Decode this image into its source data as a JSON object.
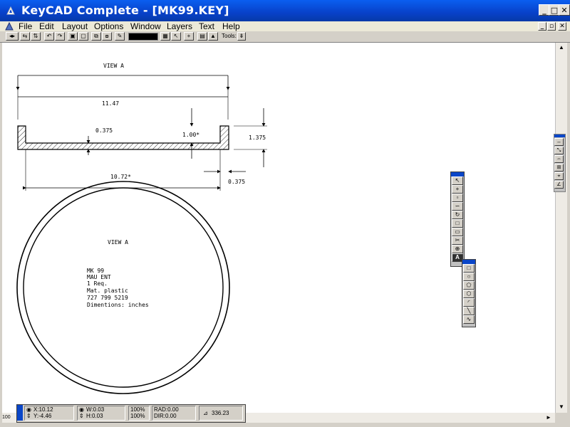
{
  "window": {
    "title": "KeyCAD Complete - [MK99.KEY]"
  },
  "titlebar_buttons": {
    "minimize": "_",
    "maximize": "□",
    "close": "✕"
  },
  "menu": {
    "items": [
      "File",
      "Edit",
      "Layout",
      "Options",
      "Window",
      "Layers",
      "Text",
      "Help"
    ]
  },
  "mdi_buttons": {
    "minimize": "_",
    "restore": "▫",
    "close": "✕"
  },
  "toolbar": {
    "tools_label": "Tools:",
    "tools_button": "⇟"
  },
  "drawing": {
    "top_view_label": "VIEW A",
    "overall_width": "11.47",
    "inner_width": "10.72*",
    "wall_thickness_left": "0.375",
    "depth": "1.00*",
    "height": "1.375",
    "wall_thickness_right": "0.375",
    "circle_view_label": "VIEW A",
    "notes": [
      "MK 99",
      "MAU ENT",
      "1 Req.",
      "Mat. plastic",
      "727 799 5219",
      "Dimentions: inches"
    ]
  },
  "status": {
    "x": "X:10.12",
    "y": "Y:-4.46",
    "w": "W:0.03",
    "h": "H:0.03",
    "zoom1": "100%",
    "zoom2": "100%",
    "rad": "RAD:0.00",
    "dir": "DIR:0.00",
    "angle": "336.23",
    "left_zoom": "100"
  },
  "scroll": {
    "up": "▲",
    "down": "▼",
    "left": "◄",
    "right": "►"
  },
  "palette_tools": [
    "select-arrow",
    "crosshair",
    "node",
    "curve",
    "rotate",
    "rectangle",
    "page",
    "scissors",
    "zoom",
    "text"
  ],
  "shape_tools": [
    "rectangle",
    "circle",
    "polygon",
    "octagon",
    "arc",
    "line",
    "freehand"
  ],
  "edge_tools": [
    "dimension",
    "resize",
    "fit",
    "grid",
    "snap",
    "angle"
  ]
}
